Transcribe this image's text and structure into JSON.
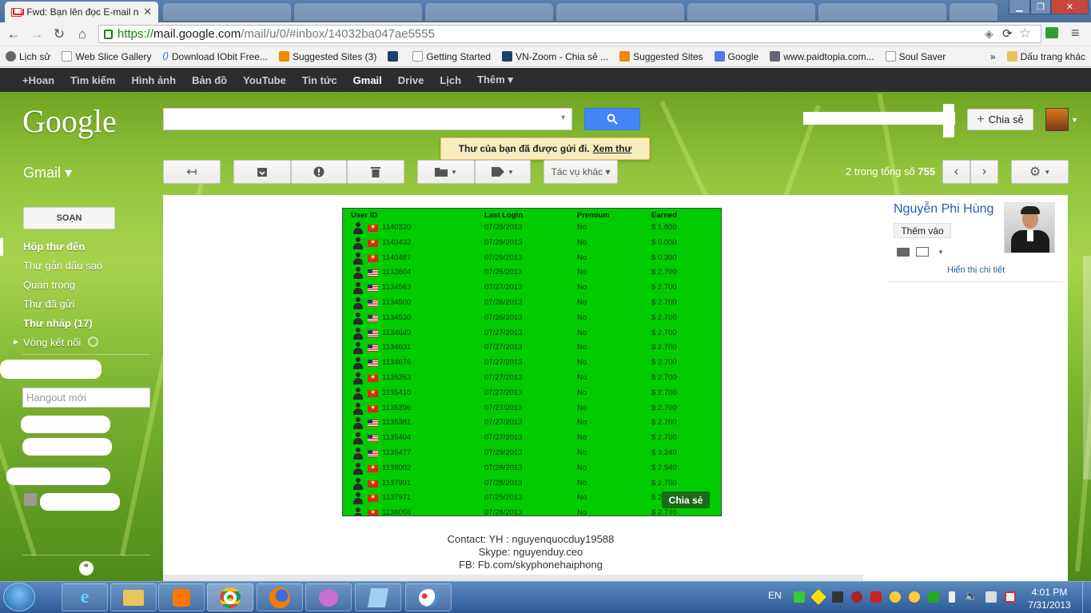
{
  "browser": {
    "active_tab_title": "Fwd: Bạn lên đọc E-mail n",
    "url_scheme": "https://",
    "url_host": "mail.google.com",
    "url_path": "/mail/u/0/#inbox/14032ba047ae5555"
  },
  "bookmarks": [
    {
      "label": "Lịch sử",
      "icon": "clock-icon"
    },
    {
      "label": "Web Slice Gallery",
      "icon": "page-icon"
    },
    {
      "label": "Download IObit Free...",
      "icon": "iobit-icon"
    },
    {
      "label": "Suggested Sites (3)",
      "icon": "suggested-sites-icon"
    },
    {
      "label": "",
      "icon": "vn-zoom-icon"
    },
    {
      "label": "Getting Started",
      "icon": "page-icon"
    },
    {
      "label": "VN-Zoom - Chia sẻ ...",
      "icon": "vn-zoom-icon"
    },
    {
      "label": "Suggested Sites",
      "icon": "suggested-sites-icon"
    },
    {
      "label": "Google",
      "icon": "google-icon"
    },
    {
      "label": "www.paidtopia.com...",
      "icon": "paidtopia-icon"
    },
    {
      "label": "Soul Saver",
      "icon": "page-icon"
    }
  ],
  "bookmarks_more": "»",
  "bookmarks_other": "Dấu trang khác",
  "gbar": [
    "+Hoan",
    "Tìm kiếm",
    "Hình ảnh",
    "Bản đồ",
    "YouTube",
    "Tin tức",
    "Gmail",
    "Drive",
    "Lịch",
    "Thêm ▾"
  ],
  "gbar_active": "Gmail",
  "header": {
    "logo": "Google",
    "share_label": "Chia sẻ",
    "share_plus": "+"
  },
  "notice": {
    "text": "Thư của bạn đã được gửi đi.",
    "link": "Xem thư"
  },
  "toolbar": {
    "gmail_label": "Gmail ▾",
    "more_actions": "Tác vụ khác ▾",
    "count_text": "2 trong tổng số",
    "count_total": "755"
  },
  "sidebar": {
    "compose": "SOẠN",
    "items": [
      {
        "label": "Hộp thư đến",
        "bold": true
      },
      {
        "label": "Thư gắn dấu sao",
        "bold": false
      },
      {
        "label": "Quan trọng",
        "bold": false
      },
      {
        "label": "Thư đã gửi",
        "bold": false
      },
      {
        "label": "Thư nháp (17)",
        "bold": true
      },
      {
        "label": "Vòng kết nối",
        "bold": false
      }
    ],
    "hangout_placeholder": "Hangout mới"
  },
  "email_table": {
    "headers": [
      "User ID",
      "Last Login",
      "Premium",
      "Earned"
    ],
    "rows": [
      {
        "id": "1140320",
        "login": "07/29/2013",
        "premium": "No",
        "earned": "$ 1.800",
        "flag": "vn"
      },
      {
        "id": "1140432",
        "login": "07/29/2013",
        "premium": "No",
        "earned": "$ 0.000",
        "flag": "vn"
      },
      {
        "id": "1140487",
        "login": "07/29/2013",
        "premium": "No",
        "earned": "$ 0.300",
        "flag": "vn"
      },
      {
        "id": "1133604",
        "login": "07/26/2013",
        "premium": "No",
        "earned": "$ 2.700",
        "flag": "us"
      },
      {
        "id": "1134563",
        "login": "07/27/2013",
        "premium": "No",
        "earned": "$ 2.700",
        "flag": "us"
      },
      {
        "id": "1134500",
        "login": "07/26/2013",
        "premium": "No",
        "earned": "$ 2.700",
        "flag": "us"
      },
      {
        "id": "1134530",
        "login": "07/26/2013",
        "premium": "No",
        "earned": "$ 2.700",
        "flag": "us"
      },
      {
        "id": "1134649",
        "login": "07/27/2013",
        "premium": "No",
        "earned": "$ 2.700",
        "flag": "us"
      },
      {
        "id": "1134631",
        "login": "07/27/2013",
        "premium": "No",
        "earned": "$ 2.700",
        "flag": "us"
      },
      {
        "id": "1134676",
        "login": "07/27/2013",
        "premium": "No",
        "earned": "$ 2.700",
        "flag": "us"
      },
      {
        "id": "1135353",
        "login": "07/27/2013",
        "premium": "No",
        "earned": "$ 2.700",
        "flag": "vn"
      },
      {
        "id": "1135410",
        "login": "07/27/2013",
        "premium": "No",
        "earned": "$ 2.700",
        "flag": "vn"
      },
      {
        "id": "1135396",
        "login": "07/27/2013",
        "premium": "No",
        "earned": "$ 2.700",
        "flag": "vn"
      },
      {
        "id": "1135381",
        "login": "07/27/2013",
        "premium": "No",
        "earned": "$ 2.700",
        "flag": "us"
      },
      {
        "id": "1135404",
        "login": "07/27/2013",
        "premium": "No",
        "earned": "$ 2.700",
        "flag": "us"
      },
      {
        "id": "1135477",
        "login": "07/29/2013",
        "premium": "No",
        "earned": "$ 3.240",
        "flag": "us"
      },
      {
        "id": "1138002",
        "login": "07/28/2013",
        "premium": "No",
        "earned": "$ 2.940",
        "flag": "vn"
      },
      {
        "id": "1137991",
        "login": "07/28/2013",
        "premium": "No",
        "earned": "$ 2.700",
        "flag": "vn"
      },
      {
        "id": "1137971",
        "login": "07/29/2013",
        "premium": "No",
        "earned": "$ 2",
        "flag": "vn"
      },
      {
        "id": "1138058",
        "login": "07/28/2013",
        "premium": "No",
        "earned": "$ 2.740",
        "flag": "vn"
      }
    ],
    "share_overlay": "Chia sẻ"
  },
  "contact_lines": [
    "Contact: YH : nguyenquocduy19588",
    "Skype: nguyenduy.ceo",
    "FB: Fb.com/skyphonehaiphong"
  ],
  "contact_card": {
    "name": "Nguyễn Phi Hùng",
    "add_label": "Thêm vào",
    "details_link": "Hiển thị chi tiết"
  },
  "taskbar": {
    "lang": "EN",
    "time": "4:01 PM",
    "date": "7/31/2013"
  }
}
